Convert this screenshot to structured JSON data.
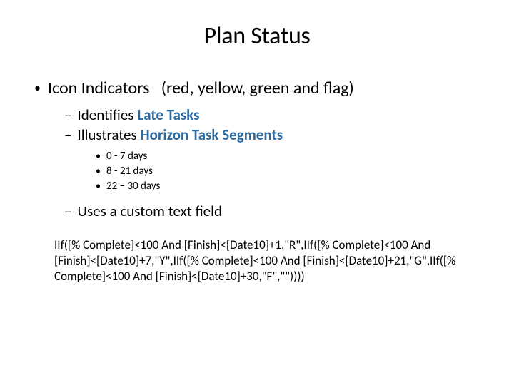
{
  "title": "Plan Status",
  "level1": {
    "text_a": "Icon Indicators",
    "text_b": "(red, yellow, green and flag)"
  },
  "sub": {
    "identifies_a": "Identifies ",
    "identifies_b": "Late Tasks",
    "illustrates_a": "Illustrates ",
    "illustrates_b": "Horizon Task Segments",
    "range1": "0 - 7 days",
    "range2": "8 - 21 days",
    "range3": "22 – 30 days",
    "custom": "Uses a custom text field"
  },
  "formula": "IIf([% Complete]<100 And [Finish]<[Date10]+1,\"R\",IIf([% Complete]<100 And [Finish]<[Date10]+7,\"Y\",IIf([% Complete]<100 And [Finish]<[Date10]+21,\"G\",IIf([% Complete]<100 And [Finish]<[Date10]+30,\"F\",\"\"))))"
}
